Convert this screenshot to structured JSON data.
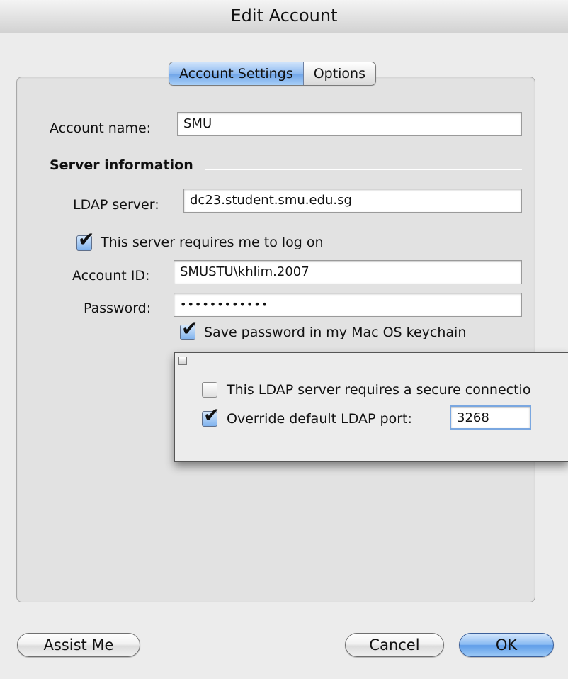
{
  "window": {
    "title": "Edit Account"
  },
  "tabs": [
    {
      "label": "Account Settings",
      "selected": true
    },
    {
      "label": "Options",
      "selected": false
    }
  ],
  "account": {
    "name_label": "Account name:",
    "name_value": "SMU"
  },
  "server": {
    "section_title": "Server information",
    "ldap_label": "LDAP server:",
    "ldap_value": "dc23.student.smu.edu.sg",
    "requires_logon_label": "This server requires me to log on",
    "requires_logon_checked": true,
    "account_id_label": "Account ID:",
    "account_id_value": "SMUSTU\\khlim.2007",
    "password_label": "Password:",
    "password_value": "••••••••••••",
    "save_password_label": "Save password in my Mac OS keychain",
    "save_password_checked": true
  },
  "popup": {
    "secure_label": "This LDAP server requires a secure connectio",
    "secure_checked": false,
    "override_port_label": "Override default LDAP port:",
    "override_port_checked": true,
    "port_value": "3268"
  },
  "buttons": {
    "assist": "Assist Me",
    "cancel": "Cancel",
    "ok": "OK"
  },
  "icons": {
    "checkmark": "✔"
  }
}
